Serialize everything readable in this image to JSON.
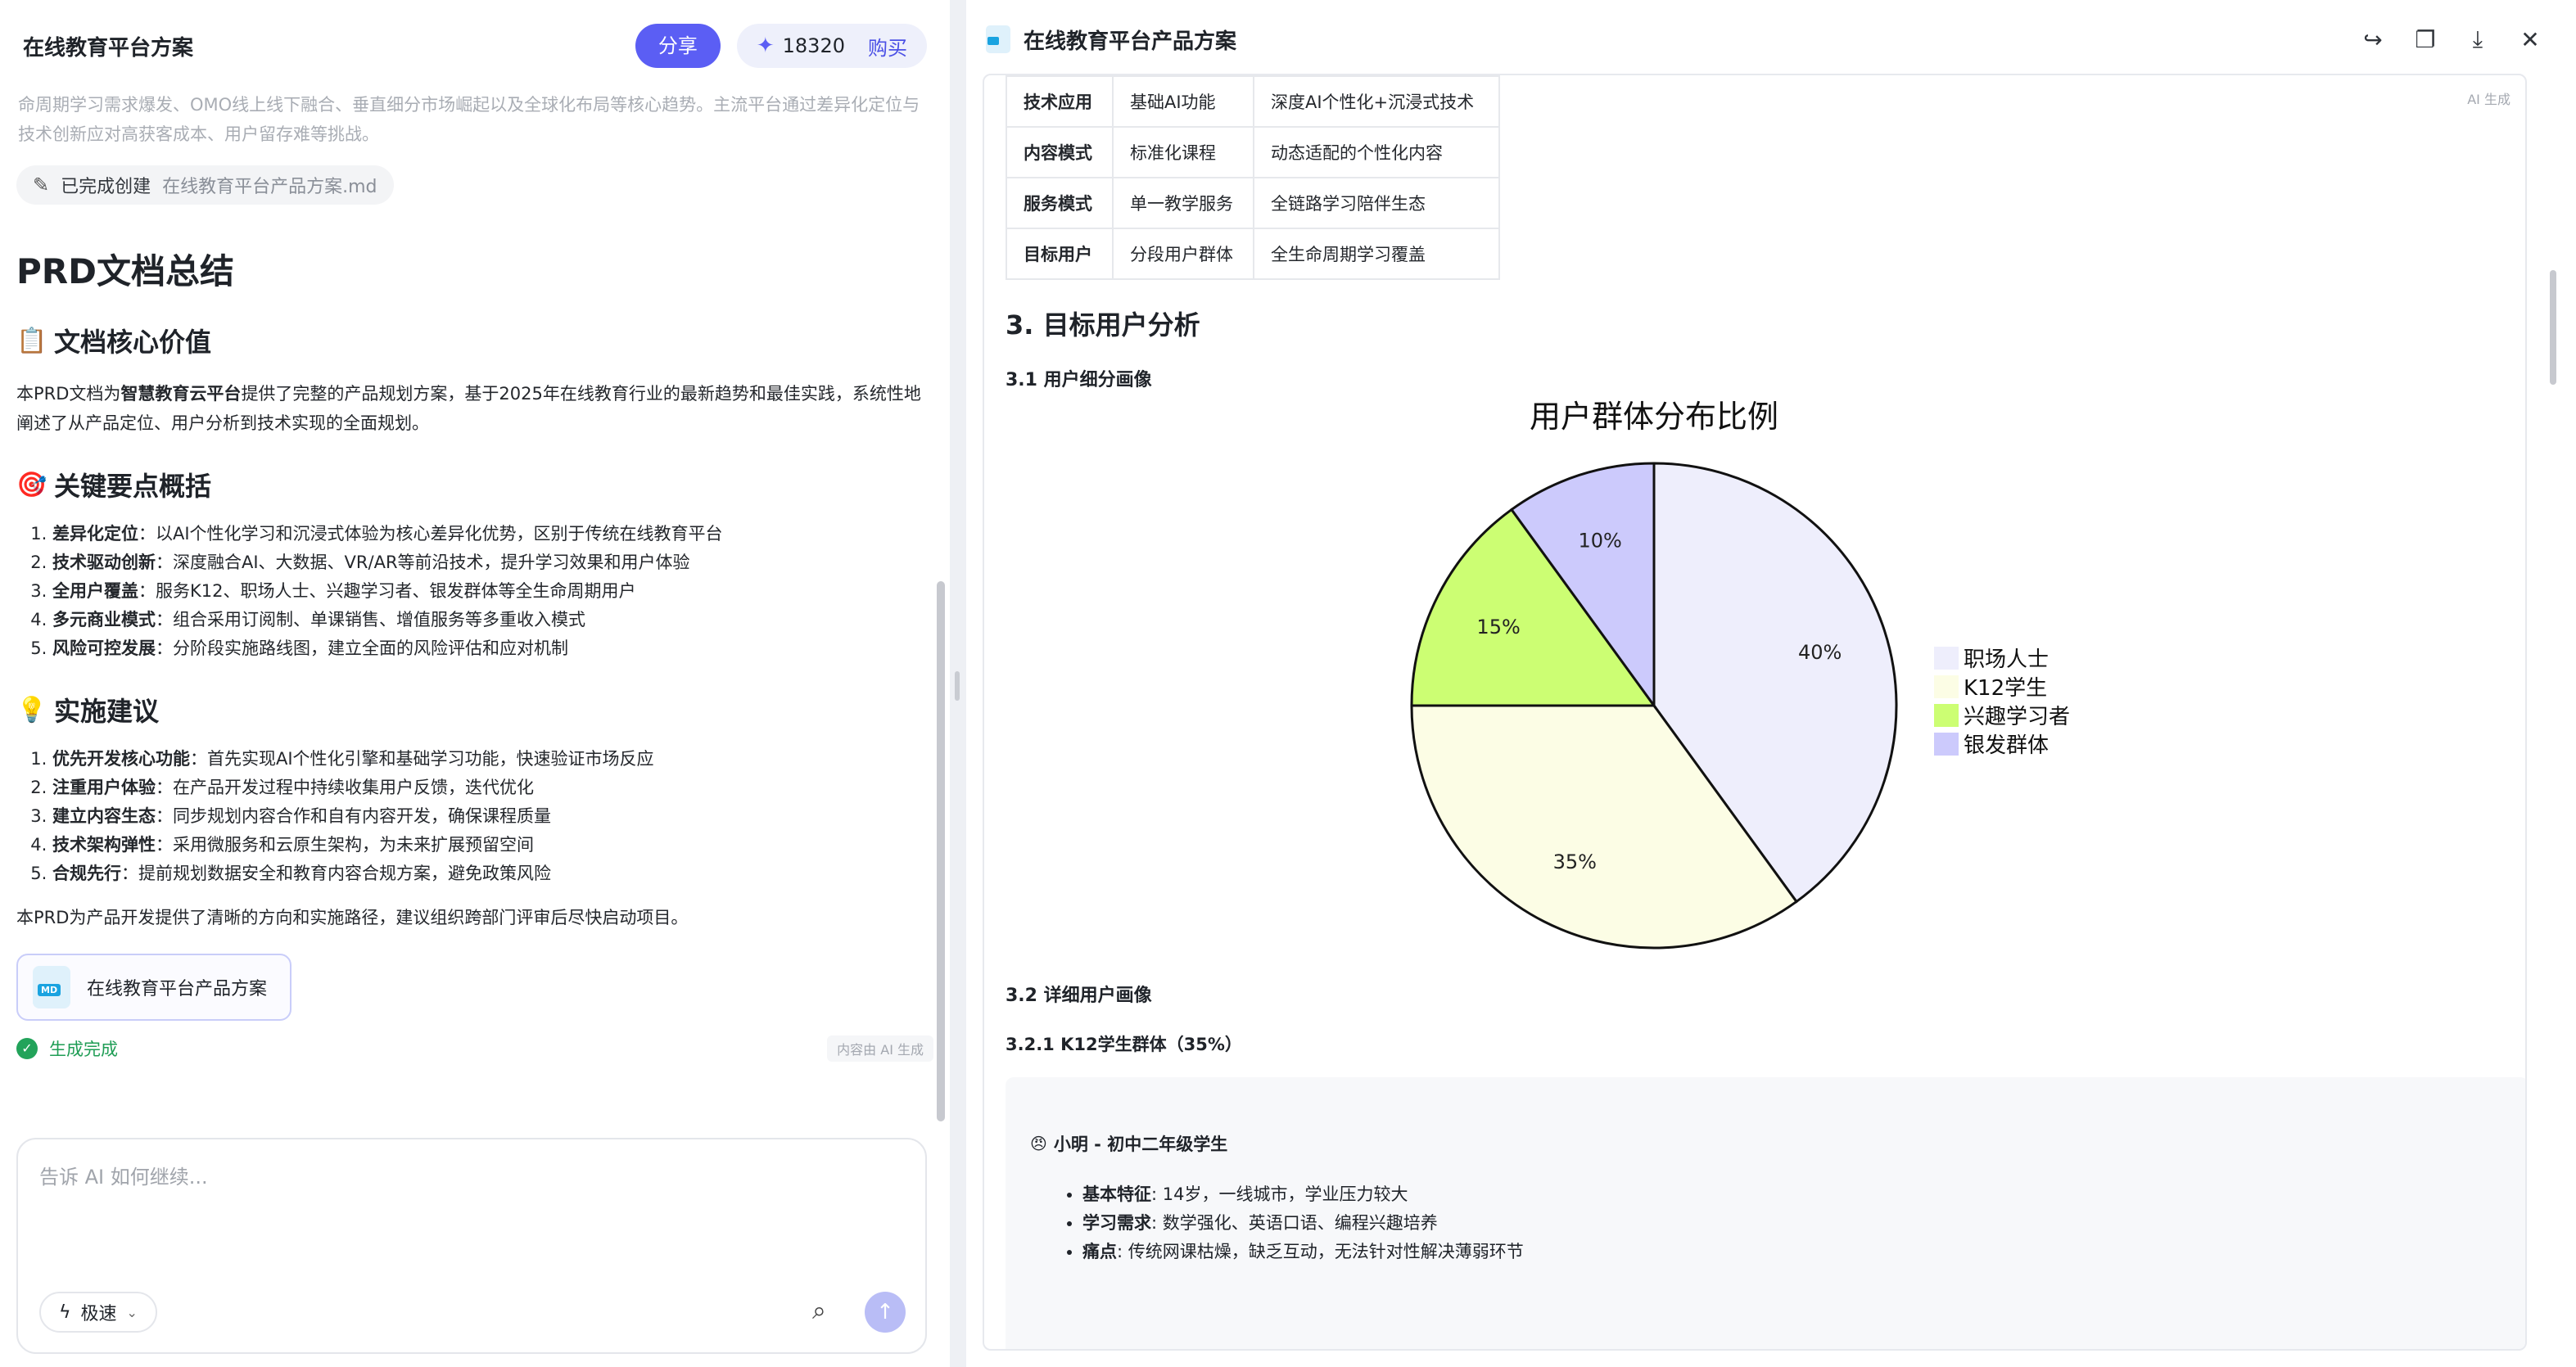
{
  "left": {
    "title": "在线教育平台方案",
    "share_label": "分享",
    "credits": "18320",
    "buy_label": "购买",
    "faded_text": "命周期学习需求爆发、OMO线上线下融合、垂直细分市场崛起以及全球化布局等核心趋势。主流平台通过差异化定位与技术创新应对高获客成本、用户留存难等挑战。",
    "chip_prefix": "已完成创建",
    "chip_file": "在线教育平台产品方案.md",
    "heading": "PRD文档总结",
    "sec_value": {
      "emoji": "📋",
      "title": "文档核心价值"
    },
    "intro_1": "本PRD文档为",
    "intro_bold": "智慧教育云平台",
    "intro_2": "提供了完整的产品规划方案，基于2025年在线教育行业的最新趋势和最佳实践，系统性地阐述了从产品定位、用户分析到技术实现的全面规划。",
    "sec_points": {
      "emoji": "🎯",
      "title": "关键要点概括"
    },
    "points": [
      {
        "b": "差异化定位",
        "t": "：以AI个性化学习和沉浸式体验为核心差异化优势，区别于传统在线教育平台"
      },
      {
        "b": "技术驱动创新",
        "t": "：深度融合AI、大数据、VR/AR等前沿技术，提升学习效果和用户体验"
      },
      {
        "b": "全用户覆盖",
        "t": "：服务K12、职场人士、兴趣学习者、银发群体等全生命周期用户"
      },
      {
        "b": "多元商业模式",
        "t": "：组合采用订阅制、单课销售、增值服务等多重收入模式"
      },
      {
        "b": "风险可控发展",
        "t": "：分阶段实施路线图，建立全面的风险评估和应对机制"
      }
    ],
    "sec_advice": {
      "emoji": "💡",
      "title": "实施建议"
    },
    "advice": [
      {
        "b": "优先开发核心功能",
        "t": "：首先实现AI个性化引擎和基础学习功能，快速验证市场反应"
      },
      {
        "b": "注重用户体验",
        "t": "：在产品开发过程中持续收集用户反馈，迭代优化"
      },
      {
        "b": "建立内容生态",
        "t": "：同步规划内容合作和自有内容开发，确保课程质量"
      },
      {
        "b": "技术架构弹性",
        "t": "：采用微服务和云原生架构，为未来扩展预留空间"
      },
      {
        "b": "合规先行",
        "t": "：提前规划数据安全和教育内容合规方案，避免政策风险"
      }
    ],
    "closing": "本PRD为产品开发提供了清晰的方向和实施路径，建议组织跨部门评审后尽快启动项目。",
    "file_card_icon": "MD",
    "file_card_label": "在线教育平台产品方案",
    "done_label": "生成完成",
    "ai_tag": "内容由 AI 生成",
    "composer_placeholder": "告诉 AI 如何继续...",
    "mode_label": "极速"
  },
  "right": {
    "title": "在线教育平台产品方案",
    "ai_gen": "AI 生成",
    "table": [
      [
        "技术应用",
        "基础AI功能",
        "深度AI个性化+沉浸式技术"
      ],
      [
        "内容模式",
        "标准化课程",
        "动态适配的个性化内容"
      ],
      [
        "服务模式",
        "单一教学服务",
        "全链路学习陪伴生态"
      ],
      [
        "目标用户",
        "分段用户群体",
        "全生命周期学习覆盖"
      ]
    ],
    "h3": "3. 目标用户分析",
    "h4_1": "3.1 用户细分画像",
    "h4_2": "3.2 详细用户画像",
    "h5": "3.2.1 K12学生群体（35%）",
    "persona_emoji": "😠",
    "persona_name": "小明 - 初中二年级学生",
    "persona_items": [
      {
        "b": "基本特征",
        "t": ": 14岁，一线城市，学业压力较大"
      },
      {
        "b": "学习需求",
        "t": ": 数学强化、英语口语、编程兴趣培养"
      },
      {
        "b": "痛点",
        "t": ": 传统网课枯燥，缺乏互动，无法针对性解决薄弱环节"
      }
    ]
  },
  "chart_data": {
    "type": "pie",
    "title": "用户群体分布比例",
    "categories": [
      "职场人士",
      "K12学生",
      "兴趣学习者",
      "银发群体"
    ],
    "values": [
      40,
      35,
      15,
      10
    ],
    "labels": [
      "40%",
      "35%",
      "15%",
      "10%"
    ],
    "colors": [
      "#eeeefc",
      "#fcfde5",
      "#ccfe73",
      "#cccafc"
    ],
    "legend": "right"
  }
}
